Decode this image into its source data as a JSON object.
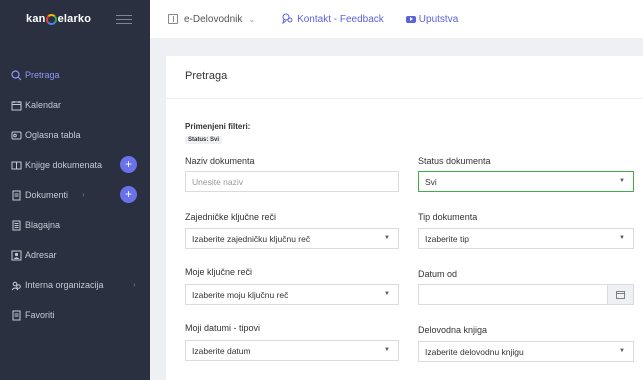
{
  "app": {
    "logo_text_left": "kan",
    "logo_text_right": "elarko"
  },
  "sidebar": {
    "items": [
      {
        "label": "Pretraga",
        "icon": "search-icon",
        "active": true
      },
      {
        "label": "Kalendar",
        "icon": "calendar-icon"
      },
      {
        "label": "Oglasna tabla",
        "icon": "board-icon"
      },
      {
        "label": "Knjige dokumenata",
        "icon": "books-icon",
        "plus": "+"
      },
      {
        "label": "Dokumenti",
        "icon": "document-icon",
        "plus": "+"
      },
      {
        "label": "Blagajna",
        "icon": "cashbox-icon"
      },
      {
        "label": "Adresar",
        "icon": "contact-icon"
      },
      {
        "label": "Interna organizacija",
        "icon": "organization-icon"
      },
      {
        "label": "Favoriti",
        "icon": "favorites-icon"
      }
    ]
  },
  "topbar": {
    "delovodnik": "e-Delovodnik",
    "kontakt": "Kontakt - Feedback",
    "uputstva": "Uputstva"
  },
  "main": {
    "title": "Pretraga",
    "filters_label": "Primenjeni filteri:",
    "filter_badge": "Status: Svi",
    "fields": {
      "naziv_label": "Naziv dokumenta",
      "naziv_placeholder": "Unesite naziv",
      "status_label": "Status dokumenta",
      "status_value": "Svi",
      "zajednicke_label": "Zajedničke ključne reči",
      "zajednicke_value": "Izaberite zajedničku ključnu reč",
      "tip_label": "Tip dokumenta",
      "tip_value": "Izaberite tip",
      "moje_label": "Moje ključne reči",
      "moje_value": "Izaberite moju ključnu reč",
      "datum_label": "Datum od",
      "datumi_label": "Moji datumi - tipovi",
      "datumi_value": "Izaberite datum",
      "knjiga_label": "Delovodna knjiga",
      "knjiga_value": "Izaberite delovodnu knjigu"
    }
  },
  "colors": {
    "sidebar_bg": "#2a3040",
    "accent": "#6a72ea",
    "link": "#5a63d8",
    "focus": "#3fae49"
  }
}
